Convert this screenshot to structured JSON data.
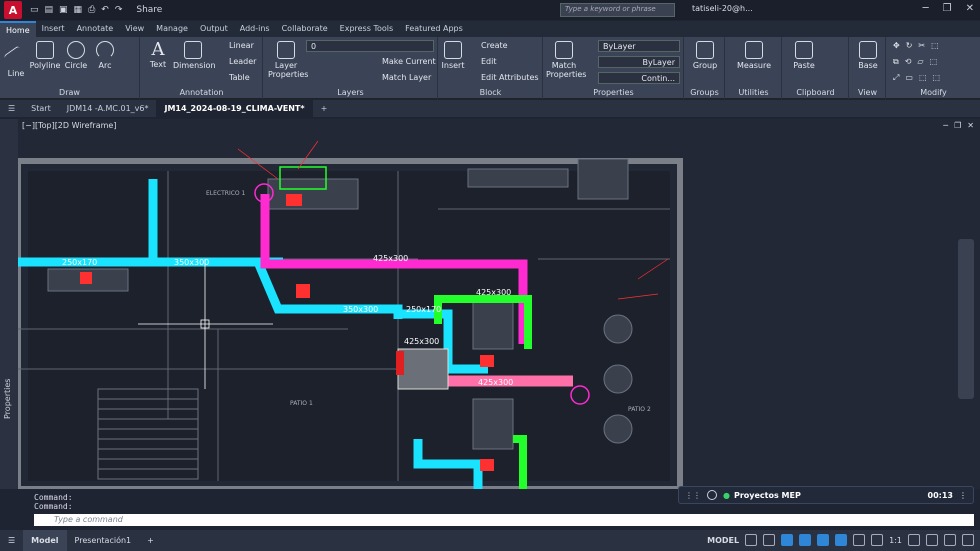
{
  "app": {
    "logo": "A",
    "share": "Share",
    "search_placeholder": "Type a keyword or phrase",
    "user": "tatiseli-20@h..."
  },
  "menu_tabs": [
    "Home",
    "Insert",
    "Annotate",
    "View",
    "Manage",
    "Output",
    "Add-ins",
    "Collaborate",
    "Express Tools",
    "Featured Apps"
  ],
  "ribbon": {
    "draw": {
      "label": "Draw",
      "tools": [
        "Line",
        "Polyline",
        "Circle",
        "Arc"
      ]
    },
    "annotation": {
      "label": "Annotation",
      "text": "Text",
      "dimension": "Dimension",
      "linear": "Linear",
      "leader": "Leader",
      "table": "Table"
    },
    "layers": {
      "label": "Layers",
      "layer_properties": "Layer Properties",
      "current_layer": "0",
      "make_current": "Make Current",
      "match_layer": "Match Layer"
    },
    "block": {
      "label": "Block",
      "insert": "Insert",
      "create": "Create",
      "edit": "Edit",
      "edit_attributes": "Edit Attributes"
    },
    "properties": {
      "label": "Properties",
      "match": "Match Properties",
      "color": "ByLayer",
      "linetype": "ByLayer",
      "lineweight": "Contin..."
    },
    "groups": {
      "label": "Groups",
      "group": "Group"
    },
    "utilities": {
      "label": "Utilities",
      "measure": "Measure"
    },
    "clipboard": {
      "label": "Clipboard",
      "paste": "Paste"
    },
    "view": {
      "label": "View",
      "base": "Base"
    },
    "modify": {
      "label": "Modify"
    }
  },
  "doc_tabs": [
    "Start",
    "JDM14 -A.MC.01_v6*",
    "JM14_2024-08-19_CLIMA-VENT*"
  ],
  "viewport_label": "[−][Top][2D Wireframe]",
  "side_panel": "Properties",
  "drawing": {
    "ducts": [
      "250x170",
      "350x300",
      "350x300",
      "250x170",
      "425x300",
      "425x300",
      "425x300",
      "425x300"
    ],
    "rooms": [
      "ELECTRICO 1",
      "PATIO 1",
      "PATIO 2"
    ]
  },
  "command": {
    "history": [
      "Command:",
      "Command:"
    ],
    "placeholder": "Type a command"
  },
  "meeting": {
    "title": "Proyectos MEP",
    "time": "00:13"
  },
  "status": {
    "tabs": [
      "Model",
      "Presentación1"
    ],
    "model": "MODEL",
    "scale": "1:1"
  }
}
